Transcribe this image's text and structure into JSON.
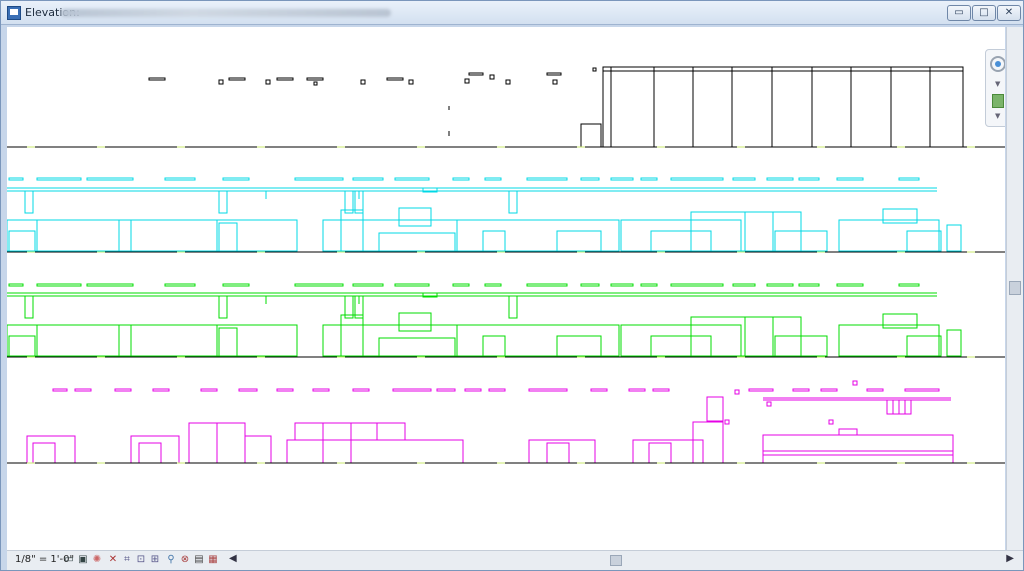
{
  "window": {
    "title": "Elevation:",
    "controls": {
      "minimize": "▭",
      "maximize": "□",
      "close": "✕"
    }
  },
  "status": {
    "scale": "1/8\" = 1'-0\""
  },
  "view_controls": [
    "detail-level-icon",
    "visual-style-icon",
    "sun-path-off-icon",
    "shadows-off-icon",
    "crop-view-icon",
    "show-crop-region-icon",
    "unlock-3d-view-icon",
    "temporary-hide-isolate-icon",
    "reveal-hidden-elements-icon",
    "worksharing-display-icon",
    "render-icon",
    "analytical-model-icon"
  ],
  "navigation_bar": {
    "items": [
      "steering-wheel-icon",
      "zoom-region-icon"
    ]
  },
  "colors": {
    "level1": "#000000",
    "level2": "#00d8e6",
    "level3": "#00dc00",
    "level4": "#e600e6",
    "level_dash": "#c8e86e"
  }
}
